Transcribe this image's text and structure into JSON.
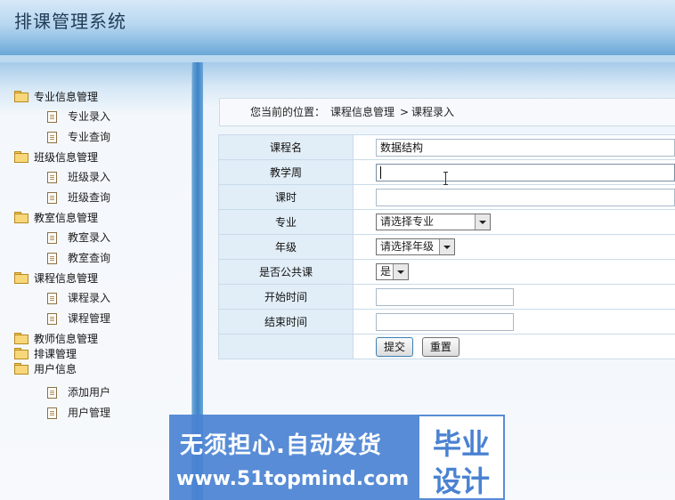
{
  "app": {
    "title": "排课管理系统"
  },
  "sidebar": {
    "groups": [
      {
        "label": "专业信息管理",
        "items": [
          "专业录入",
          "专业查询"
        ]
      },
      {
        "label": "班级信息管理",
        "items": [
          "班级录入",
          "班级查询"
        ]
      },
      {
        "label": "教室信息管理",
        "items": [
          "教室录入",
          "教室查询"
        ]
      },
      {
        "label": "课程信息管理",
        "items": [
          "课程录入",
          "课程管理"
        ]
      },
      {
        "label": "教师信息管理",
        "items": []
      },
      {
        "label": "排课管理",
        "items": []
      },
      {
        "label": "用户信息",
        "items": [
          "添加用户",
          "用户管理"
        ]
      }
    ]
  },
  "breadcrumb": {
    "label": "您当前的位置：",
    "path": "课程信息管理",
    "separator": ">",
    "current": "课程录入"
  },
  "form": {
    "course_name": {
      "label": "课程名",
      "value": "数据结构"
    },
    "teaching_week": {
      "label": "教学周",
      "value": ""
    },
    "hours": {
      "label": "课时",
      "value": ""
    },
    "major": {
      "label": "专业",
      "selected": "请选择专业"
    },
    "grade": {
      "label": "年级",
      "selected": "请选择年级"
    },
    "is_public": {
      "label": "是否公共课",
      "selected": "是"
    },
    "start_time": {
      "label": "开始时间",
      "value": ""
    },
    "end_time": {
      "label": "结束时间",
      "value": ""
    },
    "submit_label": "提交",
    "reset_label": "重置"
  },
  "watermark": {
    "line1": "无须担心.自动发货",
    "line2": "www.51topmind.com",
    "box1": "毕业",
    "box2": "设计"
  }
}
